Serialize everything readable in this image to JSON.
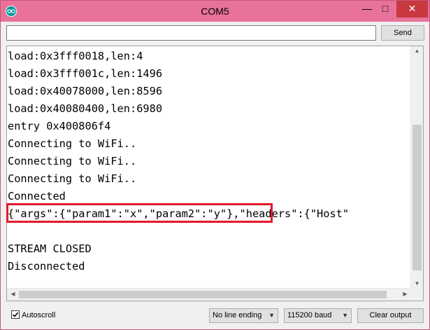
{
  "window": {
    "title": "COM5",
    "minimize_glyph": "—",
    "maximize_glyph": "□",
    "close_glyph": "✕",
    "accent_color": "#e8729a",
    "close_color": "#c7383f"
  },
  "send": {
    "input_value": "",
    "button_label": "Send"
  },
  "monitor": {
    "lines": [
      "load:0x3fff0018,len:4",
      "load:0x3fff001c,len:1496",
      "load:0x40078000,len:8596",
      "load:0x40080400,len:6980",
      "entry 0x400806f4",
      "Connecting to WiFi..",
      "Connecting to WiFi..",
      "Connecting to WiFi..",
      "Connected",
      "{\"args\":{\"param1\":\"x\",\"param2\":\"y\"},\"headers\":{\"Host\"",
      "",
      "STREAM CLOSED",
      "Disconnected"
    ],
    "highlight_color": "#e01a2b"
  },
  "bottom": {
    "autoscroll_label": "Autoscroll",
    "autoscroll_checked": true,
    "line_ending_value": "No line ending",
    "baud_value": "115200 baud",
    "clear_label": "Clear output"
  },
  "icons": {
    "app": "arduino-icon",
    "checkbox": "checkmark-icon"
  }
}
